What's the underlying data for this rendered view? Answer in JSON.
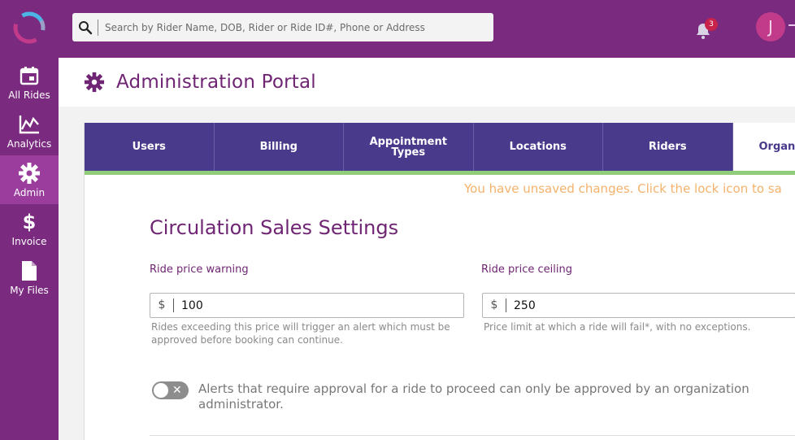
{
  "search": {
    "placeholder": "Search by Rider Name, DOB, Rider or Ride ID#, Phone or Address"
  },
  "notifications": {
    "count": "3"
  },
  "user": {
    "initial": "J"
  },
  "sidebar": {
    "items": [
      {
        "label": "All Rides",
        "icon": "calendar-icon"
      },
      {
        "label": "Analytics",
        "icon": "chart-icon"
      },
      {
        "label": "Admin",
        "icon": "gear-icon"
      },
      {
        "label": "Invoice",
        "icon": "dollar-icon"
      },
      {
        "label": "My Files",
        "icon": "file-icon"
      }
    ]
  },
  "header": {
    "title": "Administration Portal"
  },
  "tabs": [
    {
      "label": "Users"
    },
    {
      "label": "Billing"
    },
    {
      "label": "Appointment Types"
    },
    {
      "label": "Locations"
    },
    {
      "label": "Riders"
    },
    {
      "label": "Organ"
    }
  ],
  "banner": {
    "unsaved": "You have unsaved changes. Click the lock icon to sa"
  },
  "section": {
    "title": "Circulation Sales Settings"
  },
  "warning": {
    "label": "Ride price warning",
    "currency": "$",
    "value": "100",
    "help": "Rides exceeding this price will trigger an alert which must be approved before booking can continue."
  },
  "ceiling": {
    "label": "Ride price ceiling",
    "currency": "$",
    "value": "250",
    "help": "Price limit at which a ride will fail*, with no exceptions."
  },
  "approval": {
    "text": "Alerts that require approval for a ride to proceed can only be approved by an organization administrator.",
    "toggle_symbol": "✕"
  },
  "colors": {
    "brand": "#7a2a7f",
    "tab": "#4a3a8c",
    "accent_green": "#8fcd7a",
    "warning_text": "#f5b26b"
  }
}
